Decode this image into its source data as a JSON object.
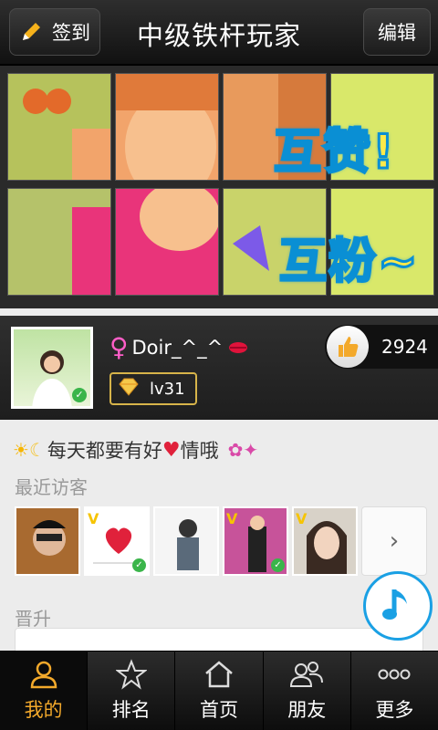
{
  "header": {
    "checkin_label": "签到",
    "title": "中级铁杆玩家",
    "edit_label": "编辑"
  },
  "mosaic": {
    "text_top": "互赞!",
    "text_bottom": "互粉~"
  },
  "profile": {
    "username": "Doir_^_^",
    "level": "lv31",
    "likes": "2924"
  },
  "signature": {
    "text_a": "每天都要有好",
    "text_b": "情哦"
  },
  "visitors": {
    "label": "最近访客",
    "items": [
      {
        "verified": false,
        "v_badge": false
      },
      {
        "verified": true,
        "v_badge": true
      },
      {
        "verified": false,
        "v_badge": false
      },
      {
        "verified": true,
        "v_badge": true
      },
      {
        "verified": false,
        "v_badge": true
      }
    ],
    "next_glyph": "›"
  },
  "promotion": {
    "label": "晋升"
  },
  "nav": {
    "items": [
      {
        "label": "我的",
        "icon": "person-icon",
        "active": true
      },
      {
        "label": "排名",
        "icon": "star-icon",
        "active": false
      },
      {
        "label": "首页",
        "icon": "home-icon",
        "active": false
      },
      {
        "label": "朋友",
        "icon": "friends-icon",
        "active": false
      },
      {
        "label": "更多",
        "icon": "more-icon",
        "active": false
      }
    ]
  },
  "colors": {
    "accent": "#f3a92b",
    "music_blue": "#1aa0e4",
    "check_green": "#3ab54a"
  }
}
